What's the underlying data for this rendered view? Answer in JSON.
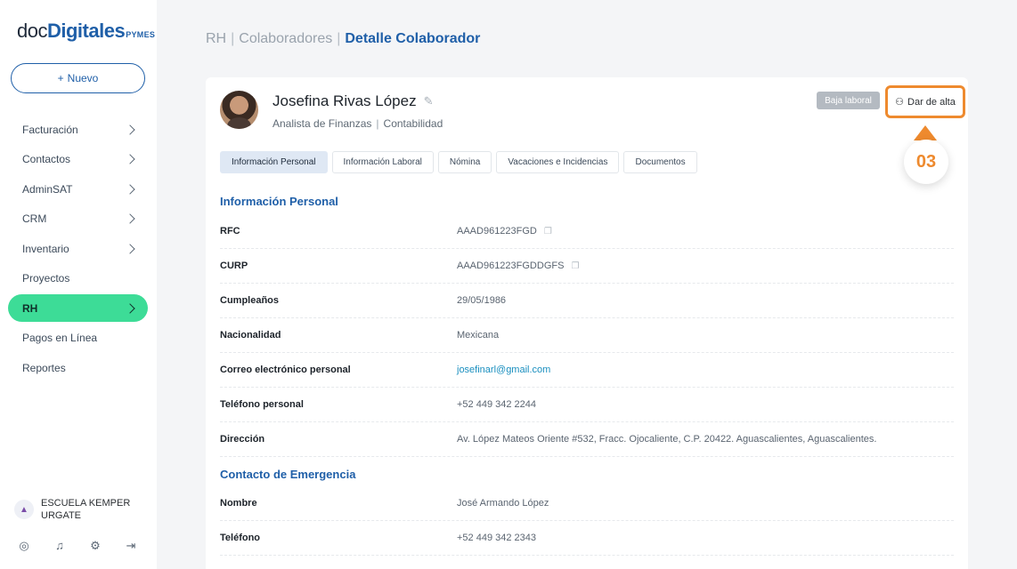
{
  "sidebar": {
    "logo": {
      "part1": "doc",
      "part2": "Digitales",
      "part3": "PYMES"
    },
    "new_button": "Nuevo",
    "items": [
      {
        "label": "Facturación",
        "chevron": true
      },
      {
        "label": "Contactos",
        "chevron": true
      },
      {
        "label": "AdminSAT",
        "chevron": true
      },
      {
        "label": "CRM",
        "chevron": true
      },
      {
        "label": "Inventario",
        "chevron": true
      },
      {
        "label": "Proyectos",
        "chevron": false
      },
      {
        "label": "RH",
        "chevron": true,
        "active": true
      },
      {
        "label": "Pagos en Línea",
        "chevron": false
      },
      {
        "label": "Reportes",
        "chevron": false
      }
    ],
    "company": "ESCUELA KEMPER URGATE",
    "bottom_icons": [
      "user-circle-icon",
      "bell-icon",
      "gear-icon",
      "logout-icon"
    ]
  },
  "breadcrumb": {
    "item1": "RH",
    "item2": "Colaboradores",
    "current": "Detalle Colaborador"
  },
  "employee": {
    "name": "Josefina Rivas López",
    "position": "Analista de Finanzas",
    "department": "Contabilidad"
  },
  "actions": {
    "baja_label": "Baja laboral",
    "alta_label": "Dar de alta"
  },
  "step_marker": "03",
  "tabs": [
    {
      "label": "Información Personal",
      "active": true
    },
    {
      "label": "Información Laboral"
    },
    {
      "label": "Nómina"
    },
    {
      "label": "Vacaciones e Incidencias"
    },
    {
      "label": "Documentos"
    }
  ],
  "personal": {
    "title": "Información Personal",
    "rows": [
      {
        "label": "RFC",
        "value": "AAAD961223FGD"
      },
      {
        "label": "CURP",
        "value": "AAAD961223FGDDGFS"
      },
      {
        "label": "Cumpleaños",
        "value": "29/05/1986"
      },
      {
        "label": "Nacionalidad",
        "value": "Mexicana"
      },
      {
        "label": "Correo electrónico personal",
        "value": "josefinarl@gmail.com"
      },
      {
        "label": "Teléfono personal",
        "value": "+52 449 342 2244"
      },
      {
        "label": "Dirección",
        "value": "Av. López Mateos Oriente #532, Fracc. Ojocaliente, C.P. 20422. Aguascalientes, Aguascalientes."
      }
    ]
  },
  "emergency": {
    "title": "Contacto de Emergencia",
    "rows": [
      {
        "label": "Nombre",
        "value": "José Armando López"
      },
      {
        "label": "Teléfono",
        "value": "+52 449 342 2343"
      }
    ]
  },
  "colors": {
    "primary": "#1f5fa8",
    "active_nav": "#3ddc97",
    "highlight": "#ee8a2e"
  }
}
